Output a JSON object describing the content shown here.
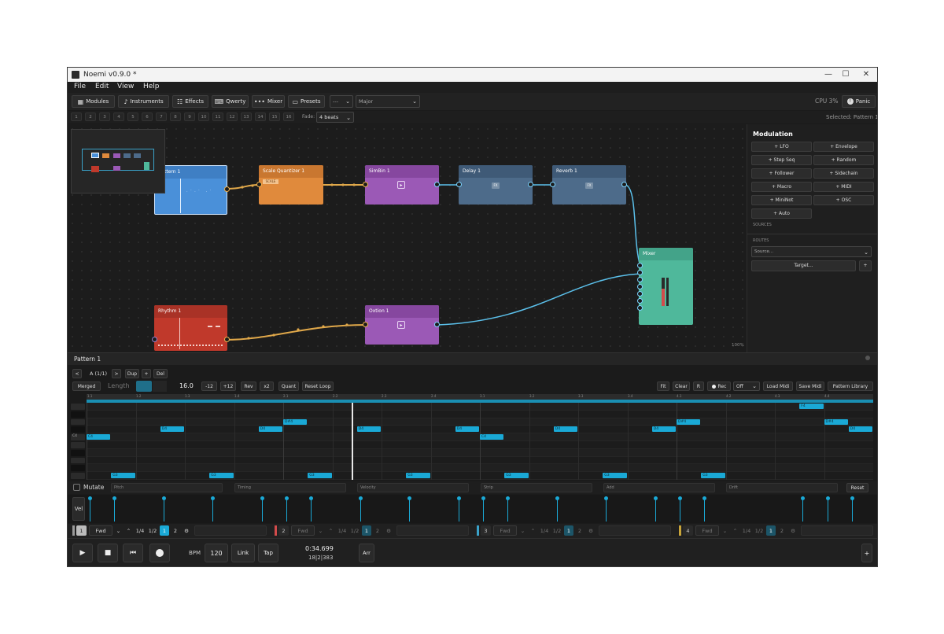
{
  "window": {
    "title": "Noemi v0.9.0 *",
    "controls": [
      "—",
      "☐",
      "✕"
    ]
  },
  "menu": [
    "File",
    "Edit",
    "View",
    "Help"
  ],
  "toolbar": {
    "buttons": [
      {
        "label": "Modules",
        "icon": "grid-icon"
      },
      {
        "label": "Instruments",
        "icon": "music-note-icon"
      },
      {
        "label": "Effects",
        "icon": "sliders-icon"
      },
      {
        "label": "Qwerty",
        "icon": "keyboard-icon"
      },
      {
        "label": "Mixer",
        "icon": "dots-icon"
      },
      {
        "label": "Presets",
        "icon": "folder-icon"
      }
    ],
    "root_select": "---",
    "scale_select": "Major",
    "cpu": "CPU 3%",
    "panic": "Panic"
  },
  "patterns": {
    "numbers": [
      "1",
      "2",
      "3",
      "4",
      "5",
      "6",
      "7",
      "8",
      "9",
      "10",
      "11",
      "12",
      "13",
      "14",
      "15",
      "16"
    ],
    "fade_label": "Fade:",
    "fade_value": "4 beats",
    "selected": "Selected: Pattern 1"
  },
  "nodes": {
    "pattern1": "Pattern 1",
    "scale_quantizer": "Scale Quantizer 1",
    "scale_badge": "SCALE",
    "simbin": "SimBin 1",
    "delay": "Delay 1",
    "reverb": "Reverb 1",
    "fx": "FX",
    "mixer": "Mixer",
    "rhythm": "Rhythm 1",
    "oxion": "Oxtion 1",
    "zoom": "100%"
  },
  "modulation": {
    "title": "Modulation",
    "buttons": [
      "+ LFO",
      "+ Envelope",
      "+ Step Seq",
      "+ Random",
      "+ Follower",
      "+ Sidechain",
      "+ Macro",
      "+ MIDI",
      "+ MiniNot",
      "+ OSC",
      "+ Auto"
    ],
    "sources_label": "SOURCES",
    "routes_label": "ROUTES",
    "source_placeholder": "Source...",
    "target_button": "Target...",
    "add": "+"
  },
  "pattern_editor": {
    "title": "Pattern 1",
    "prev": "<",
    "pattern_name": "A (1/1)",
    "next": ">",
    "dup": "Dup",
    "plus": "+",
    "del": "Del",
    "merged": "Merged",
    "length_label": "Length",
    "length_value": "16.0",
    "tools": [
      "-12",
      "+12",
      "Rev",
      "x2",
      "Quant",
      "Reset Loop"
    ],
    "right_tools": [
      "Fit",
      "Clear",
      "R"
    ],
    "rec": "Rec",
    "rec_mode": "Off",
    "load_midi": "Load Midi",
    "save_midi": "Save Midi",
    "library": "Pattern Library",
    "ruler": [
      "1.1",
      "1.2",
      "1.3",
      "1.4",
      "2.1",
      "2.2",
      "2.3",
      "2.4",
      "3.1",
      "3.2",
      "3.3",
      "3.4",
      "4.1",
      "4.2",
      "4.3",
      "4.4"
    ],
    "row_label": "C4",
    "notes": [
      {
        "label": "D4",
        "step": 1.5,
        "row": 3
      },
      {
        "label": "D#4",
        "step": 4,
        "row": 2
      },
      {
        "label": "D4",
        "step": 3.5,
        "row": 3
      },
      {
        "label": "D4",
        "step": 5.5,
        "row": 3
      },
      {
        "label": "D4",
        "step": 7.5,
        "row": 3
      },
      {
        "label": "D4",
        "step": 9.5,
        "row": 3
      },
      {
        "label": "D4",
        "step": 11.5,
        "row": 3
      },
      {
        "label": "D#4",
        "step": 12,
        "row": 2
      },
      {
        "label": "F4",
        "step": 14.5,
        "row": 0
      },
      {
        "label": "D#4",
        "step": 15,
        "row": 2
      },
      {
        "label": "D4",
        "step": 15.5,
        "row": 3
      },
      {
        "label": "C4",
        "step": 0,
        "row": 4
      },
      {
        "label": "C4",
        "step": 8,
        "row": 4
      },
      {
        "label": "G3",
        "step": 0.5,
        "row": 9
      },
      {
        "label": "G3",
        "step": 2.5,
        "row": 9
      },
      {
        "label": "G3",
        "step": 4.5,
        "row": 9
      },
      {
        "label": "G3",
        "step": 6.5,
        "row": 9
      },
      {
        "label": "G3",
        "step": 8.5,
        "row": 9
      },
      {
        "label": "G3",
        "step": 10.5,
        "row": 9
      },
      {
        "label": "G3",
        "step": 12.5,
        "row": 9
      }
    ],
    "mutate": "Mutate",
    "lanes": [
      "Pitch",
      "Timing",
      "Velocity",
      "Strip",
      "Add",
      "Drift"
    ],
    "reset": "Reset",
    "vel": "Vel"
  },
  "tracks": [
    {
      "num": "1",
      "mode": "Fwd",
      "div1": "1/4",
      "div2": "1/2",
      "a": "1",
      "b": "2",
      "color": "#9a9a9a"
    },
    {
      "num": "2",
      "mode": "Fwd",
      "div1": "1/4",
      "div2": "1/2",
      "a": "1",
      "b": "2",
      "color": "#d24b4b"
    },
    {
      "num": "3",
      "mode": "Fwd",
      "div1": "1/4",
      "div2": "1/2",
      "a": "1",
      "b": "2",
      "color": "#3aa2c9"
    },
    {
      "num": "4",
      "mode": "Fwd",
      "div1": "1/4",
      "div2": "1/2",
      "a": "1",
      "b": "2",
      "color": "#c9a53a"
    }
  ],
  "transport": {
    "bpm_label": "BPM",
    "bpm": "120",
    "link": "Link",
    "tap": "Tap",
    "time": "0:34.699",
    "position": "18|2|383",
    "arr": "Arr",
    "plus": "+"
  },
  "colors": {
    "accent": "#1aa9d6",
    "pattern": "#4a90d9",
    "quantizer": "#e08a3c",
    "synth": "#9b59b6",
    "fx": "#4d6b8a",
    "mixer": "#4fb89b",
    "rhythm": "#c0392b"
  }
}
